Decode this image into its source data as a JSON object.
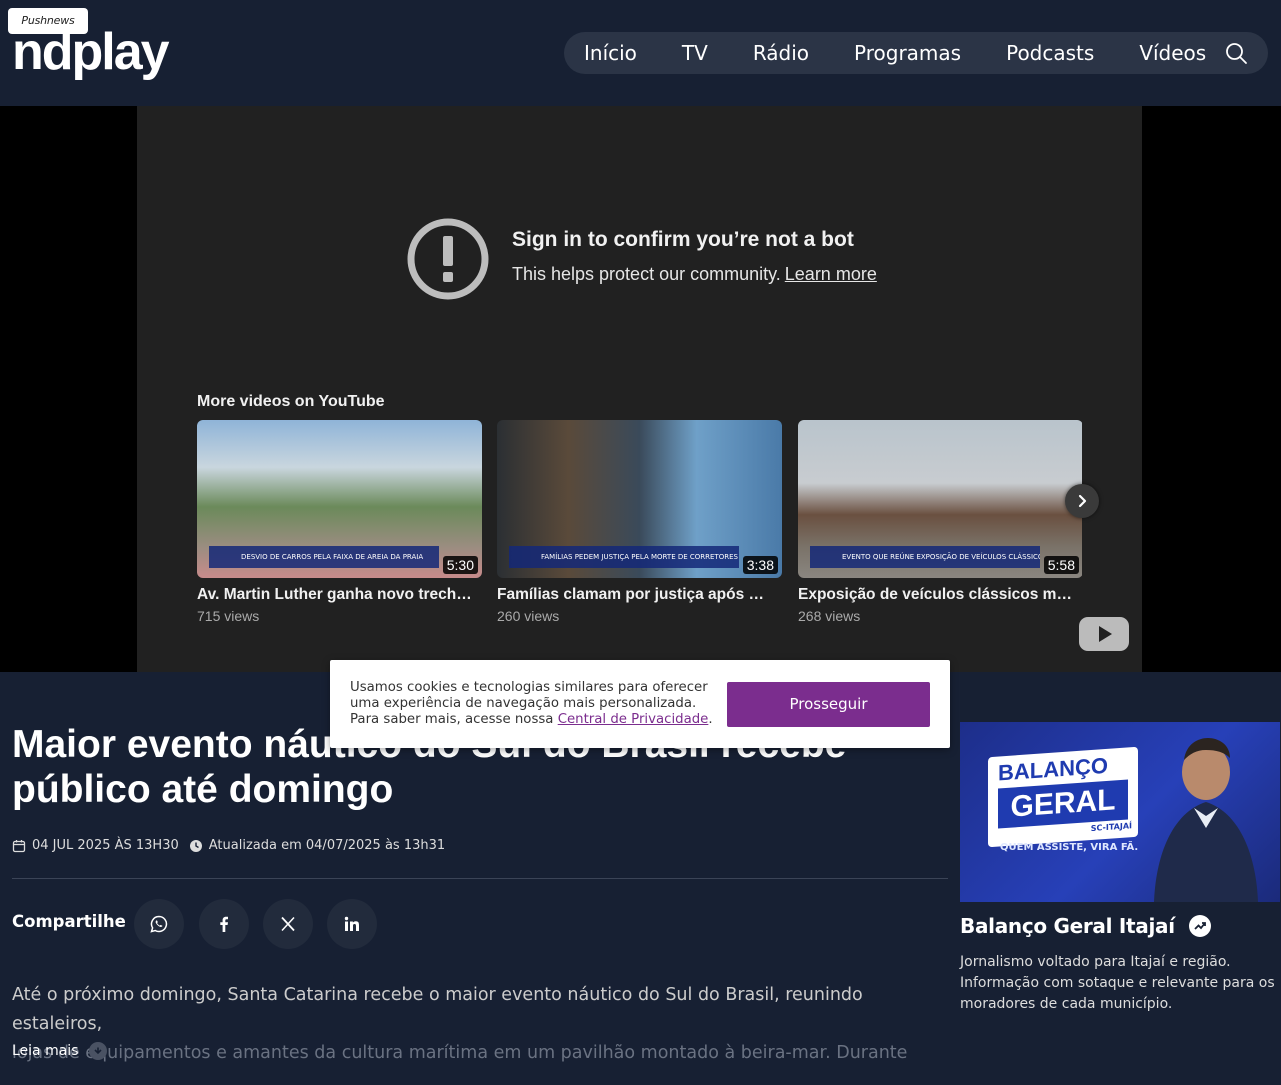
{
  "header": {
    "pushnews_label": "Pushnews",
    "logo_text": "ndplay",
    "nav": [
      "Início",
      "TV",
      "Rádio",
      "Programas",
      "Podcasts",
      "Vídeos"
    ]
  },
  "player": {
    "warning_title": "Sign in to confirm you’re not a bot",
    "warning_sub": "This helps protect our community.",
    "learn_more": "Learn more",
    "more_videos_title": "More videos on YouTube",
    "videos": [
      {
        "title": "Av. Martin Luther ganha novo trecho; ...",
        "views": "715 views",
        "duration": "5:30",
        "lower_third": "DESVIO DE CARROS PELA FAIXA DE AREIA DA PRAIA"
      },
      {
        "title": "Famílias clamam por justiça após mo...",
        "views": "260 views",
        "duration": "3:38",
        "lower_third": "FAMÍLIAS PEDEM JUSTIÇA PELA MORTE DE CORRETORES"
      },
      {
        "title": "Exposição de veículos clássicos movi...",
        "views": "268 views",
        "duration": "5:58",
        "lower_third": "EVENTO QUE REÚNE EXPOSIÇÃO DE VEÍCULOS CLÁSSICOS"
      }
    ]
  },
  "cookie": {
    "text": "Usamos cookies e tecnologias similares para oferecer uma experiência de navegação mais personalizada. Para saber mais, acesse nossa",
    "link": "Central de Privacidade",
    "button": "Prosseguir"
  },
  "article": {
    "headline": "Maior evento náutico do Sul do Brasil recebe público até domingo",
    "date": "04 JUL 2025 ÀS 13H30",
    "updated": "Atualizada em 04/07/2025 às 13h31",
    "share_label": "Compartilhe",
    "body_line1": "Até o próximo domingo, Santa Catarina recebe o maior evento náutico do Sul do Brasil, reunindo estaleiros,",
    "body_line2": "lojas de equipamentos e amantes da cultura marítima em um pavilhão montado à beira-mar. Durante",
    "read_more": "Leia mais"
  },
  "sidebar": {
    "promo_line1": "BALANÇO",
    "promo_line2": "GERAL",
    "promo_line3": "SC-ITAJAÍ",
    "promo_tag": "QUEM ASSISTE, VIRA FÃ.",
    "title": "Balanço Geral Itajaí",
    "description": "Jornalismo voltado para Itajaí e região. Informação com sotaque e relevante para os moradores de cada município."
  },
  "colors": {
    "page_bg": "#172033",
    "accent_purple": "#7b2d8e",
    "player_bg": "#212121"
  }
}
